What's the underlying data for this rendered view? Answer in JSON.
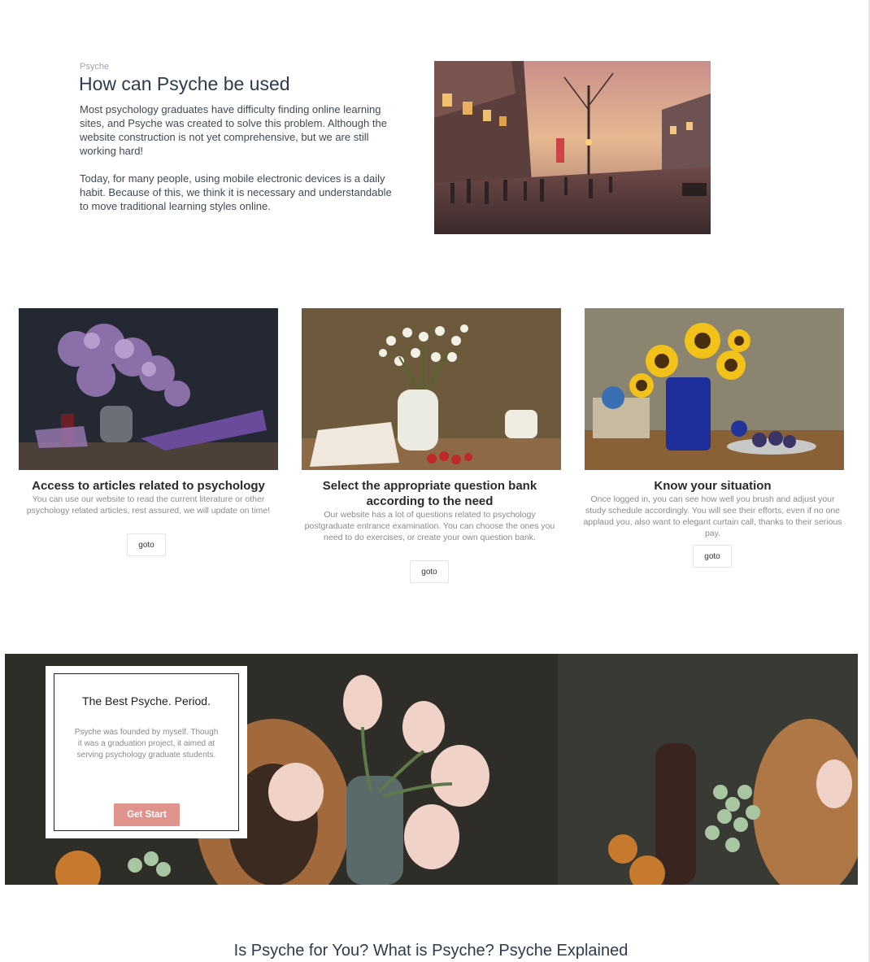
{
  "intro": {
    "eyebrow": "Psyche",
    "title": "How can Psyche be used",
    "paragraph1": "Most psychology graduates have difficulty finding online learning sites, and Psyche was created to solve this problem. Although the website construction is not yet comprehensive, but we are still working hard!",
    "paragraph2": "Today, for many people, using mobile electronic devices is a daily habit. Because of this, we think it is necessary and understandable to move traditional learning styles online."
  },
  "cards": [
    {
      "title": "Access to articles related to psychology",
      "description": "You can use our website to read the current literature or other psychology related articles, rest assured, we will update on time!",
      "button": "goto",
      "image": "lilac-still-life"
    },
    {
      "title": "Select the appropriate question bank according to the need",
      "description": "Our website has a lot of questions related to psychology postgraduate entrance examination. You can choose the ones you need to do exercises, or create your own question bank.",
      "button": "goto",
      "image": "daisy-still-life"
    },
    {
      "title": "Know your situation",
      "description": "Once logged in, you can see how well you brush and adjust your study schedule accordingly. You will see their efforts, even if no one applaud you, also want to elegant curtain call, thanks to their serious pay.",
      "button": "goto",
      "image": "sunflower-still-life"
    }
  ],
  "promo": {
    "title": "The Best Psyche. Period.",
    "text": "Psyche was founded by myself. Though it was a graduation project, it aimed at serving psychology graduate students.",
    "button": "Get Start"
  },
  "footer_heading": "Is Psyche for You? What is Psyche? Psyche Explained",
  "colors": {
    "accent_button": "#e0928d",
    "heading": "#2c3b4d"
  }
}
